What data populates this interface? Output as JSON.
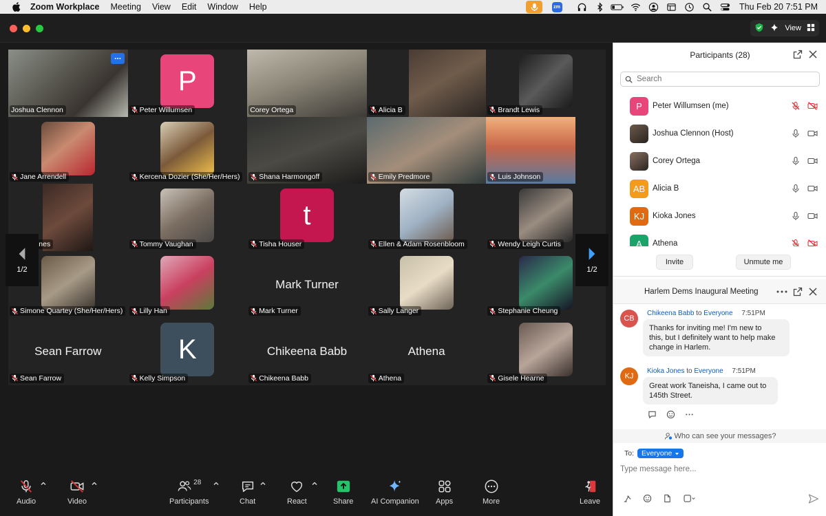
{
  "menubar": {
    "app_name": "Zoom Workplace",
    "menus": [
      "Meeting",
      "View",
      "Edit",
      "Window",
      "Help"
    ],
    "zoom_icon_text": "zm",
    "datetime": "Thu Feb 20  7:51 PM"
  },
  "window": {
    "view_label": "View"
  },
  "gallery": {
    "page_indicator_left": "1/2",
    "page_indicator_right": "1/2",
    "tiles": [
      {
        "name": "Joshua Clennon",
        "kind": "video",
        "muted": false,
        "active": true
      },
      {
        "name": "Peter Willumsen",
        "kind": "avatar",
        "letter": "P",
        "color": "#e8457a",
        "muted": true
      },
      {
        "name": "Corey Ortega",
        "kind": "video",
        "muted": false
      },
      {
        "name": "Alicia B",
        "kind": "video",
        "muted": true
      },
      {
        "name": "Brandt Lewis",
        "kind": "video",
        "muted": true
      },
      {
        "name": "Jane Arrendell",
        "kind": "video",
        "muted": true
      },
      {
        "name": "Kercena Dozier (She/Her/Hers)",
        "kind": "video",
        "muted": true
      },
      {
        "name": "Shana Harmongoff",
        "kind": "video",
        "muted": true
      },
      {
        "name": "Emily Predmore",
        "kind": "video",
        "muted": true
      },
      {
        "name": "Luis Johnson",
        "kind": "video",
        "muted": true
      },
      {
        "name": "Kioka Jones",
        "kind": "video",
        "muted": false
      },
      {
        "name": "Tommy Vaughan",
        "kind": "video",
        "muted": true
      },
      {
        "name": "Tisha Houser",
        "kind": "avatar",
        "letter": "t",
        "color": "#c4174f",
        "muted": true
      },
      {
        "name": "Ellen & Adam Rosenbloom",
        "kind": "video",
        "muted": true
      },
      {
        "name": "Wendy Leigh Curtis",
        "kind": "video",
        "muted": true
      },
      {
        "name": "Simone Quartey (She/Her/Hers)",
        "kind": "video",
        "muted": true
      },
      {
        "name": "Lilly Han",
        "kind": "video",
        "muted": true
      },
      {
        "name": "Mark Turner",
        "kind": "name",
        "muted": true
      },
      {
        "name": "Sally Langer",
        "kind": "video",
        "muted": true
      },
      {
        "name": "Stephanie Cheung",
        "kind": "video",
        "muted": true
      },
      {
        "name": "Sean Farrow",
        "kind": "name",
        "muted": true
      },
      {
        "name": "Kelly Simpson",
        "kind": "avatar",
        "letter": "K",
        "color": "#3d4f5c",
        "muted": true
      },
      {
        "name": "Chikeena Babb",
        "kind": "name",
        "muted": true
      },
      {
        "name": "Athena",
        "kind": "name",
        "muted": true
      },
      {
        "name": "Gisele Hearne",
        "kind": "video",
        "muted": true
      }
    ]
  },
  "toolbar": {
    "audio": "Audio",
    "video": "Video",
    "participants": "Participants",
    "participants_count": "28",
    "chat": "Chat",
    "react": "React",
    "share": "Share",
    "ai_companion": "AI Companion",
    "apps": "Apps",
    "more": "More",
    "leave": "Leave"
  },
  "participants_panel": {
    "title": "Participants (28)",
    "search_placeholder": "Search",
    "list": [
      {
        "name": "Peter Willumsen (me)",
        "avatar": "P",
        "color": "#e8457a",
        "mic_muted": true,
        "cam_off": true
      },
      {
        "name": "Joshua Clennon (Host)",
        "avatar": "",
        "color": "#6b5a4a",
        "mic_muted": false,
        "cam_off": false
      },
      {
        "name": "Corey Ortega",
        "avatar": "",
        "color": "#8a7062",
        "mic_muted": false,
        "cam_off": false
      },
      {
        "name": "Alicia B",
        "avatar": "AB",
        "color": "#f29b1d",
        "mic_muted": false,
        "cam_off": false
      },
      {
        "name": "Kioka Jones",
        "avatar": "KJ",
        "color": "#e06a12",
        "mic_muted": false,
        "cam_off": false
      },
      {
        "name": "Athena",
        "avatar": "A",
        "color": "#1aa46a",
        "mic_muted": true,
        "cam_off": true
      }
    ],
    "invite": "Invite",
    "unmute_me": "Unmute me"
  },
  "chat_panel": {
    "title": "Harlem Dems Inaugural Meeting",
    "messages": [
      {
        "avatar": "CB",
        "color": "#d9534f",
        "sender": "Chikeena Babb",
        "to": "to",
        "recipient": "Everyone",
        "time": "7:51PM",
        "lines": [
          "Thanks for inviting me! I'm new to",
          "this, but I definitely want to help make",
          "change in Harlem."
        ]
      },
      {
        "avatar": "KJ",
        "color": "#e06a12",
        "sender": "Kioka Jones",
        "to": "to",
        "recipient": "Everyone",
        "time": "7:51PM",
        "lines": [
          "Great work Taneisha, I came out to",
          "145th Street."
        ]
      }
    ],
    "visibility": "Who can see your messages?",
    "to_label": "To:",
    "recipient": "Everyone",
    "input_placeholder": "Type message here..."
  },
  "colors": {
    "active_speaker": "#2fd04a",
    "accent_blue": "#1676ea",
    "mute_red": "#e0363c",
    "share_green": "#25c46b"
  }
}
